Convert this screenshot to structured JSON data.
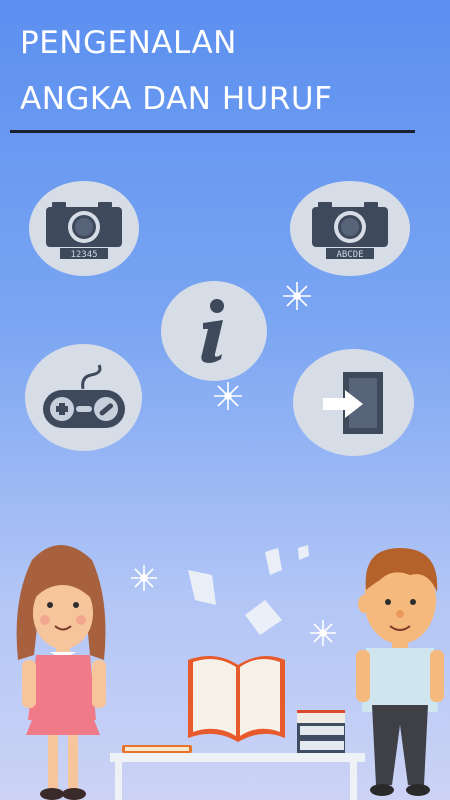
{
  "header": {
    "title_line1": "PENGENALAN",
    "title_line2": "ANGKA DAN HURUF"
  },
  "menu": {
    "numbers_camera_label": "12345",
    "letters_camera_label": "ABCDE",
    "info_icon": "info-icon",
    "game_icon": "gamepad-icon",
    "exit_icon": "exit-door-icon"
  },
  "colors": {
    "background_top": "#5b8ff0",
    "background_bottom": "#ccd3f5",
    "button_circle": "#d7dde7",
    "icon_dark": "#3e4a5c",
    "title_text": "#ffffff"
  }
}
